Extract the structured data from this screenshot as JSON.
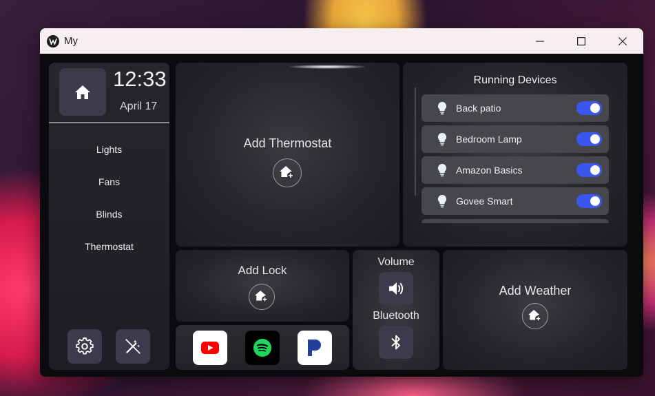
{
  "window": {
    "title": "My"
  },
  "sidebar": {
    "time": "12:33",
    "date": "April 17",
    "nav": [
      "Lights",
      "Fans",
      "Blinds",
      "Thermostat"
    ]
  },
  "thermostat": {
    "label": "Add Thermostat"
  },
  "running": {
    "title": "Running Devices",
    "devices": [
      {
        "name": "Back patio",
        "on": true
      },
      {
        "name": "Bedroom Lamp",
        "on": true
      },
      {
        "name": "Amazon Basics",
        "on": true
      },
      {
        "name": "Govee Smart",
        "on": true
      }
    ]
  },
  "lock": {
    "label": "Add Lock"
  },
  "audio": {
    "volume_label": "Volume",
    "bluetooth_label": "Bluetooth"
  },
  "weather": {
    "label": "Add Weather"
  },
  "apps": [
    "youtube-icon",
    "spotify-icon",
    "pandora-icon"
  ],
  "colors": {
    "accent": "#3b57f0",
    "button_bg": "#3b3b4b",
    "youtube": "#ff0000",
    "spotify": "#1ed760",
    "pandora": "#224099"
  }
}
